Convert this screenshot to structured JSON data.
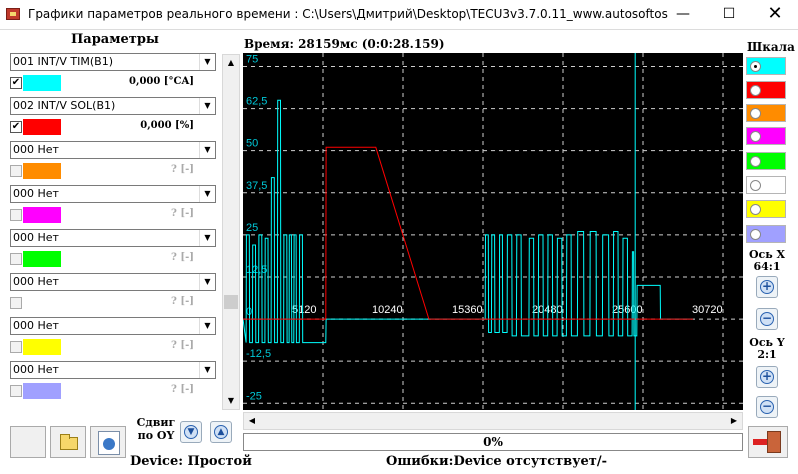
{
  "window": {
    "title": "Графики параметров реального времени : C:\\Users\\Дмитрий\\Desktop\\TECU3v3.7.0.11_www.autosoftos.com\\TEC...",
    "minimize": "—",
    "maximize": "☐",
    "close": "✕"
  },
  "params_panel": {
    "title": "Параметры",
    "rows": [
      {
        "select": "001 INT/V TIM(B1)",
        "checked": true,
        "color": "#00ffff",
        "value": "0,000 [°CA]"
      },
      {
        "select": "002 INT/V SOL(B1)",
        "checked": true,
        "color": "#ff0000",
        "value": "0,000 [%]"
      },
      {
        "select": "000 Нет",
        "checked": false,
        "color": "#ff8c00",
        "value": "? [-]"
      },
      {
        "select": "000 Нет",
        "checked": false,
        "color": "#ff00ff",
        "value": "? [-]"
      },
      {
        "select": "000 Нет",
        "checked": false,
        "color": "#00ff00",
        "value": "? [-]"
      },
      {
        "select": "000 Нет",
        "checked": false,
        "color": "#ffffff",
        "value": "? [-]"
      },
      {
        "select": "000 Нет",
        "checked": false,
        "color": "#ffff00",
        "value": "? [-]"
      },
      {
        "select": "000 Нет",
        "checked": false,
        "color": "#a0a0ff",
        "value": "? [-]"
      }
    ],
    "check_mark": "✔"
  },
  "chart_header": {
    "time": "Время: 28159мс (0:0:28.159)"
  },
  "chart_data": {
    "type": "line",
    "y_ticks": [
      "75",
      "62,5",
      "50",
      "37,5",
      "25",
      "12,5",
      "0",
      "-12,5",
      "-25"
    ],
    "y_values": [
      75,
      62.5,
      50,
      37.5,
      25,
      12.5,
      0,
      -12.5,
      -25
    ],
    "x_ticks": [
      "5120",
      "10240",
      "15360",
      "20480",
      "25600",
      "30720"
    ],
    "x_values": [
      5120,
      10240,
      15360,
      20480,
      25600,
      30720
    ],
    "xlim": [
      0,
      32000
    ],
    "ylim": [
      -27,
      79
    ],
    "grid": true,
    "cursor_x": 25100,
    "series": [
      {
        "color": "#00ffff",
        "points": [
          [
            0,
            0
          ],
          [
            200,
            -7
          ],
          [
            220,
            25
          ],
          [
            400,
            25
          ],
          [
            420,
            -7
          ],
          [
            600,
            -7
          ],
          [
            620,
            22
          ],
          [
            800,
            22
          ],
          [
            820,
            -7
          ],
          [
            1000,
            -7
          ],
          [
            1020,
            25
          ],
          [
            1200,
            25
          ],
          [
            1220,
            -7
          ],
          [
            1400,
            -7
          ],
          [
            1420,
            24
          ],
          [
            1600,
            24
          ],
          [
            1620,
            -7
          ],
          [
            1800,
            -7
          ],
          [
            1820,
            42
          ],
          [
            2000,
            42
          ],
          [
            2020,
            -7
          ],
          [
            2200,
            -7
          ],
          [
            2220,
            65
          ],
          [
            2400,
            65
          ],
          [
            2420,
            -7
          ],
          [
            2600,
            -7
          ],
          [
            2620,
            25
          ],
          [
            2800,
            25
          ],
          [
            2820,
            -7
          ],
          [
            2950,
            -7
          ],
          [
            2960,
            25
          ],
          [
            3100,
            25
          ],
          [
            3120,
            -7
          ],
          [
            3250,
            -7
          ],
          [
            3270,
            25
          ],
          [
            3400,
            25
          ],
          [
            3420,
            -7
          ],
          [
            3600,
            -7
          ],
          [
            3620,
            25
          ],
          [
            3800,
            25
          ],
          [
            3820,
            -7
          ],
          [
            5300,
            -7
          ],
          [
            5320,
            0
          ],
          [
            15500,
            0
          ],
          [
            15520,
            25
          ],
          [
            15700,
            25
          ],
          [
            15720,
            -4
          ],
          [
            15900,
            -4
          ],
          [
            15920,
            25
          ],
          [
            16100,
            25
          ],
          [
            16120,
            -4
          ],
          [
            16400,
            -4
          ],
          [
            16420,
            25
          ],
          [
            16600,
            25
          ],
          [
            16620,
            -4
          ],
          [
            16900,
            -4
          ],
          [
            16920,
            25
          ],
          [
            17200,
            25
          ],
          [
            17220,
            -5
          ],
          [
            17500,
            -5
          ],
          [
            17520,
            25
          ],
          [
            17800,
            25
          ],
          [
            17820,
            -5
          ],
          [
            18300,
            -5
          ],
          [
            18320,
            24
          ],
          [
            18600,
            24
          ],
          [
            18620,
            -5
          ],
          [
            18900,
            -5
          ],
          [
            18920,
            25
          ],
          [
            19200,
            25
          ],
          [
            19220,
            -5
          ],
          [
            19500,
            -5
          ],
          [
            19520,
            25
          ],
          [
            19800,
            25
          ],
          [
            19820,
            -5
          ],
          [
            20100,
            -5
          ],
          [
            20120,
            24
          ],
          [
            20400,
            24
          ],
          [
            20420,
            -5
          ],
          [
            20700,
            -5
          ],
          [
            20720,
            25
          ],
          [
            21000,
            25
          ],
          [
            21020,
            -5
          ],
          [
            21400,
            -5
          ],
          [
            21420,
            26
          ],
          [
            21800,
            26
          ],
          [
            21820,
            -5
          ],
          [
            22200,
            -5
          ],
          [
            22220,
            26
          ],
          [
            22600,
            26
          ],
          [
            22620,
            -5
          ],
          [
            23000,
            -5
          ],
          [
            23020,
            25
          ],
          [
            23400,
            25
          ],
          [
            23420,
            -5
          ],
          [
            23700,
            -5
          ],
          [
            23720,
            26
          ],
          [
            24000,
            26
          ],
          [
            24020,
            -5
          ],
          [
            24300,
            -5
          ],
          [
            24320,
            24
          ],
          [
            24600,
            24
          ],
          [
            24620,
            -5
          ],
          [
            24900,
            -5
          ],
          [
            24920,
            20
          ],
          [
            25000,
            20
          ],
          [
            25020,
            -5
          ],
          [
            25200,
            -5
          ],
          [
            25220,
            10
          ],
          [
            26700,
            10
          ],
          [
            26720,
            0
          ],
          [
            28800,
            0
          ]
        ]
      },
      {
        "color": "#ff0000",
        "points": [
          [
            0,
            0
          ],
          [
            5300,
            0
          ],
          [
            5320,
            51
          ],
          [
            8500,
            51
          ],
          [
            11900,
            0
          ],
          [
            28800,
            0
          ]
        ]
      }
    ]
  },
  "scale_panel": {
    "title": "Шкала",
    "colors": [
      "#00ffff",
      "#ff0000",
      "#ff8c00",
      "#ff00ff",
      "#00ff00",
      "#ffffff",
      "#ffff00",
      "#a0a0ff"
    ],
    "selected_index": 0,
    "x_axis": {
      "label": "Ось X",
      "zoom": "64:1"
    },
    "y_axis": {
      "label": "Ось Y",
      "zoom": "2:1"
    },
    "zoom_in": "+",
    "zoom_out": "−"
  },
  "bottom": {
    "shift_label": "Сдвиг по OY",
    "shift_down": "▼",
    "shift_up": "▲",
    "progress": "0%",
    "device": "Device: Простой",
    "errors": "Ошибки:Device отсутствует/-"
  }
}
